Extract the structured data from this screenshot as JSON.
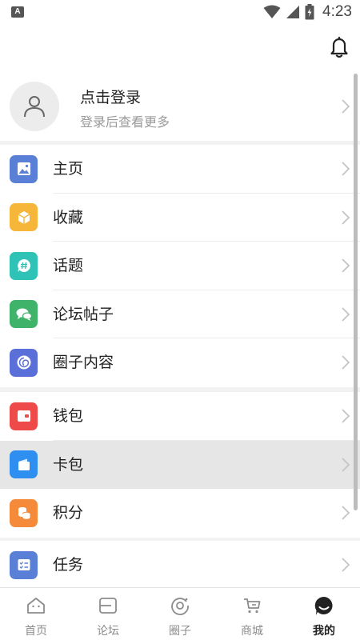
{
  "status_bar": {
    "app_badge": "A",
    "time": "4:23"
  },
  "profile": {
    "title": "点击登录",
    "subtitle": "登录后查看更多"
  },
  "groups": [
    {
      "items": [
        {
          "label": "主页",
          "icon": "image-icon",
          "color": "#5a7fd6"
        },
        {
          "label": "收藏",
          "icon": "box-icon",
          "color": "#f6b63a"
        },
        {
          "label": "话题",
          "icon": "hashtag-chat-icon",
          "color": "#2fc2b6"
        },
        {
          "label": "论坛帖子",
          "icon": "chat-bubbles-icon",
          "color": "#3fb36a"
        },
        {
          "label": "圈子内容",
          "icon": "circle-swirl-icon",
          "color": "#5b6fd8"
        }
      ]
    },
    {
      "items": [
        {
          "label": "钱包",
          "icon": "wallet-icon",
          "color": "#ef4a4a"
        },
        {
          "label": "卡包",
          "icon": "card-holder-icon",
          "color": "#2f8ff0",
          "active": true
        },
        {
          "label": "积分",
          "icon": "coins-icon",
          "color": "#f58a3a"
        }
      ]
    },
    {
      "items": [
        {
          "label": "任务",
          "icon": "task-list-icon",
          "color": "#5a7fd6"
        }
      ]
    }
  ],
  "tabbar": {
    "active_index": 4,
    "tabs": [
      {
        "label": "首页",
        "icon": "home-face-icon"
      },
      {
        "label": "论坛",
        "icon": "forum-icon"
      },
      {
        "label": "圈子",
        "icon": "circle-icon"
      },
      {
        "label": "商城",
        "icon": "cart-icon"
      },
      {
        "label": "我的",
        "icon": "profile-chat-icon"
      }
    ]
  }
}
